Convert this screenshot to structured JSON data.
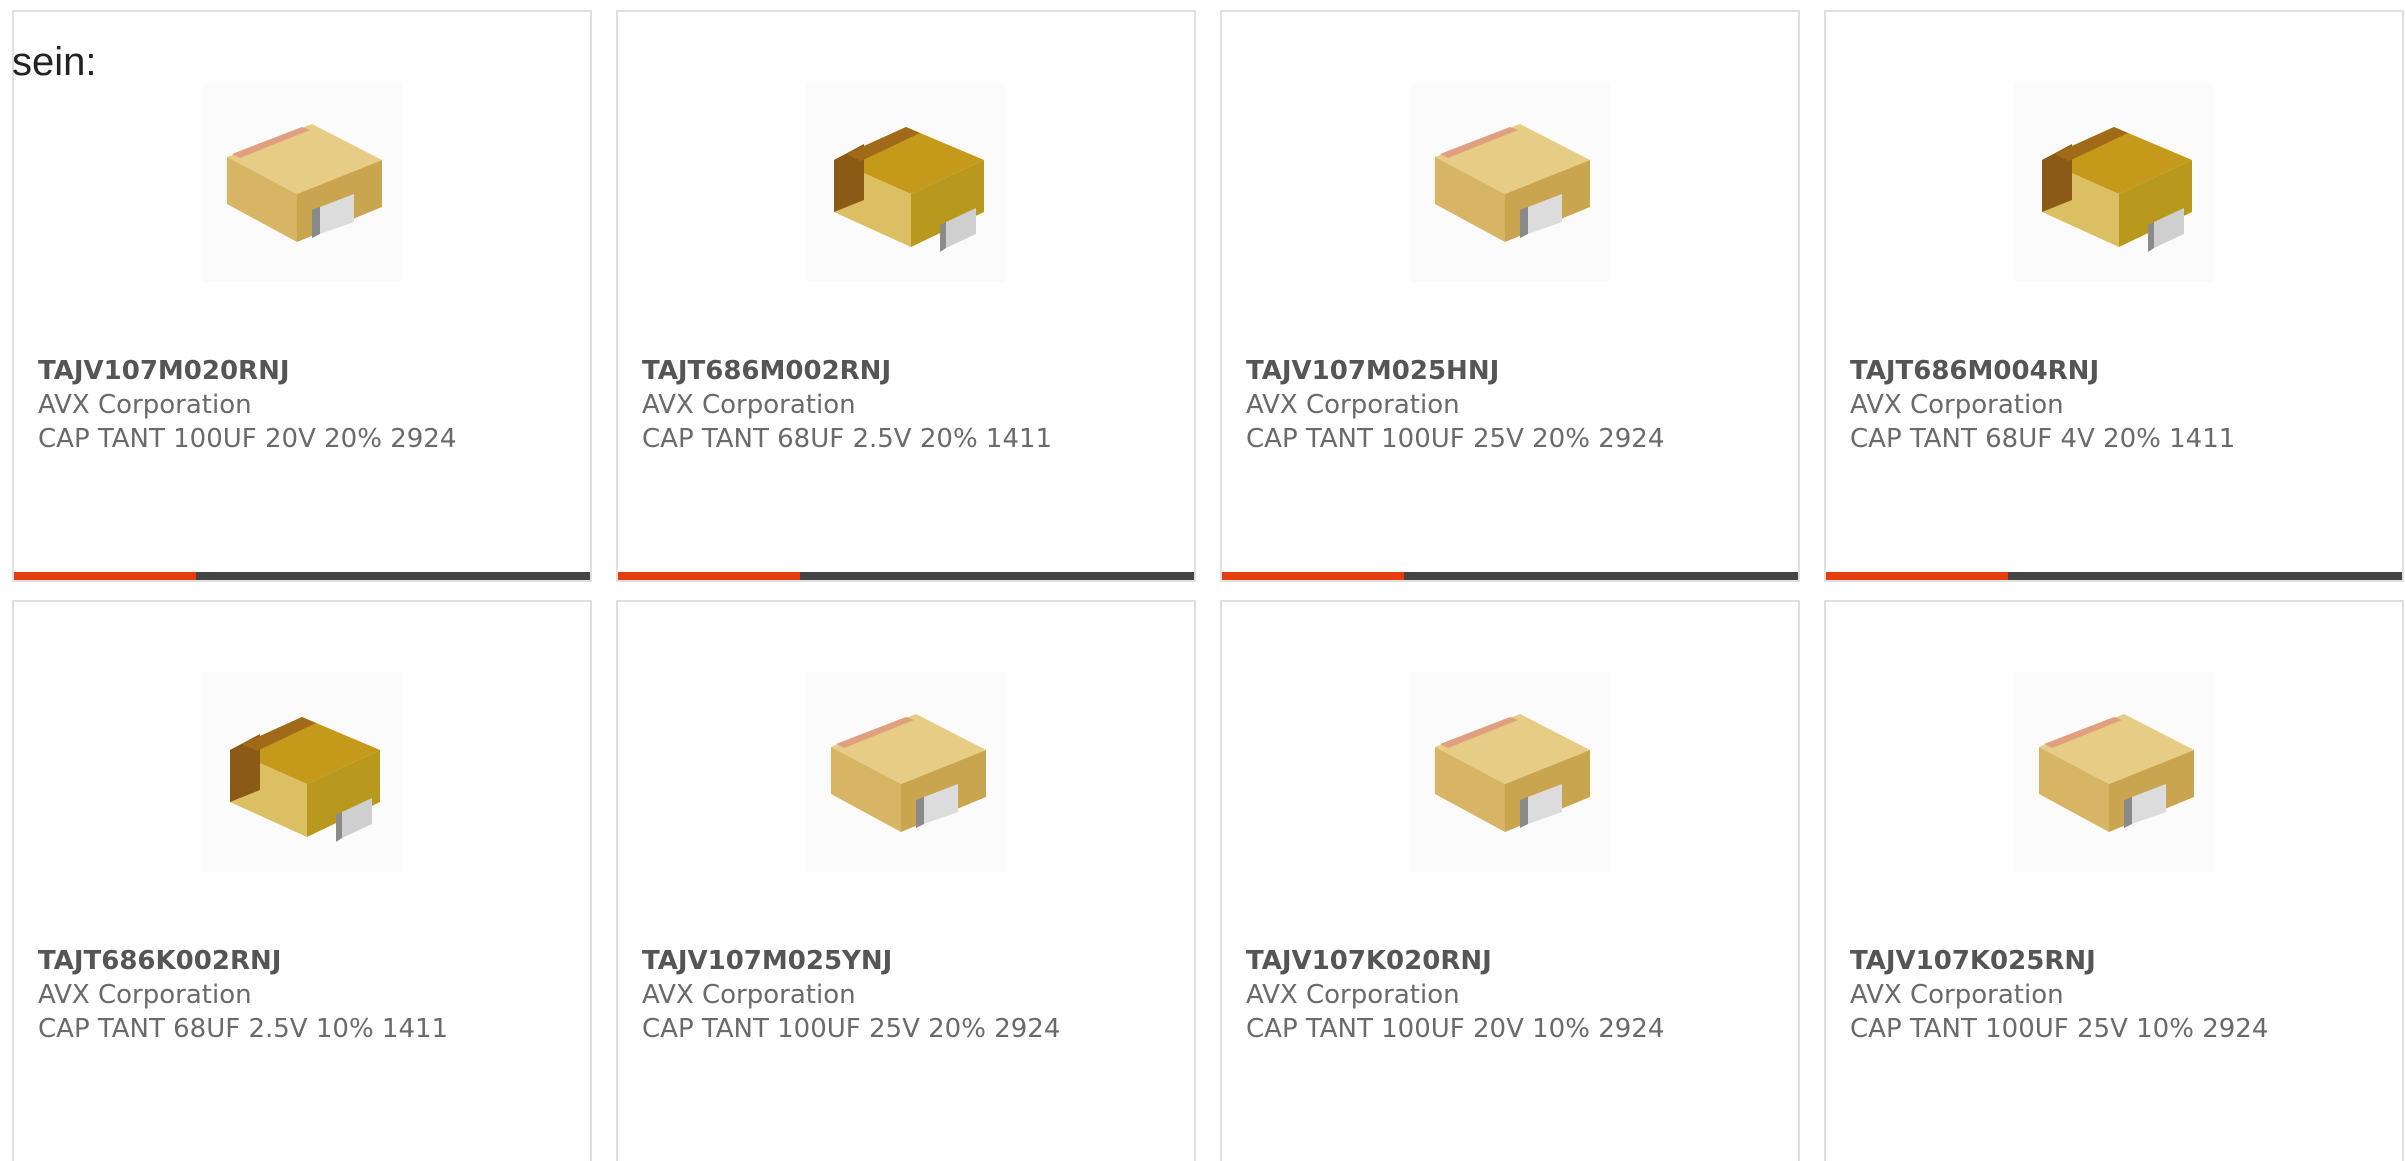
{
  "intro_text": "sein:",
  "colors": {
    "accent": "#e53c10",
    "track": "#444444",
    "border": "#e0e0e0"
  },
  "products": [
    {
      "part": "TAJV107M020RNJ",
      "maker": "AVX Corporation",
      "desc": "CAP TANT 100UF 20V 20% 2924",
      "image": "tantalum-capacitor-light",
      "progress": 0.316
    },
    {
      "part": "TAJT686M002RNJ",
      "maker": "AVX Corporation",
      "desc": "CAP TANT 68UF 2.5V 20% 1411",
      "image": "tantalum-capacitor-dark",
      "progress": 0.316
    },
    {
      "part": "TAJV107M025HNJ",
      "maker": "AVX Corporation",
      "desc": "CAP TANT 100UF 25V 20% 2924",
      "image": "tantalum-capacitor-light",
      "progress": 0.316
    },
    {
      "part": "TAJT686M004RNJ",
      "maker": "AVX Corporation",
      "desc": "CAP TANT 68UF 4V 20% 1411",
      "image": "tantalum-capacitor-dark",
      "progress": 0.316
    },
    {
      "part": "TAJT686K002RNJ",
      "maker": "AVX Corporation",
      "desc": "CAP TANT 68UF 2.5V 10% 1411",
      "image": "tantalum-capacitor-dark"
    },
    {
      "part": "TAJV107M025YNJ",
      "maker": "AVX Corporation",
      "desc": "CAP TANT 100UF 25V 20% 2924",
      "image": "tantalum-capacitor-light"
    },
    {
      "part": "TAJV107K020RNJ",
      "maker": "AVX Corporation",
      "desc": "CAP TANT 100UF 20V 10% 2924",
      "image": "tantalum-capacitor-light"
    },
    {
      "part": "TAJV107K025RNJ",
      "maker": "AVX Corporation",
      "desc": "CAP TANT 100UF 25V 10% 2924",
      "image": "tantalum-capacitor-light"
    }
  ]
}
